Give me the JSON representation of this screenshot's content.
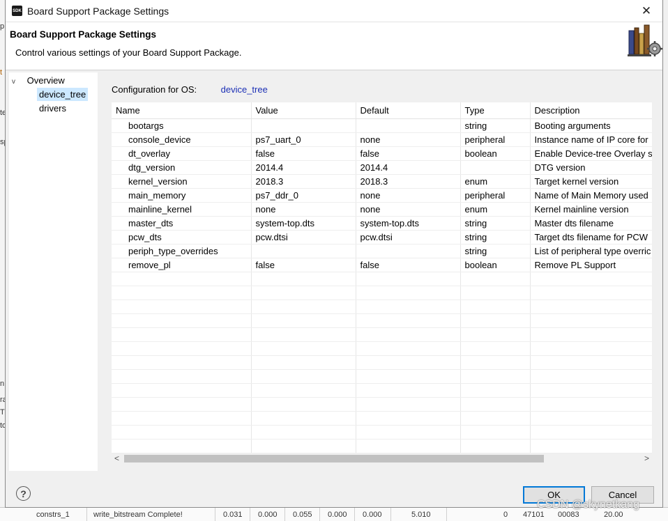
{
  "background": {
    "left_fragments": [
      "p",
      "t",
      "te",
      "sp",
      "n",
      "ra",
      "TC",
      "to"
    ],
    "bottom_cells": [
      "constrs_1",
      "write_bitstream Complete!",
      "0.031",
      "0.000",
      "0.055",
      "0.000",
      "0.000",
      "5.010",
      "0",
      "47101",
      "00083",
      "20.00"
    ]
  },
  "dialog": {
    "window_title": "Board Support Package Settings",
    "app_icon_text": "SDK",
    "close_glyph": "✕",
    "header_title": "Board Support Package Settings",
    "header_description": "Control various settings of your Board Support Package."
  },
  "tree": {
    "root": {
      "label": "Overview",
      "twisty": "v"
    },
    "children": [
      {
        "label": "device_tree",
        "selected": true
      },
      {
        "label": "drivers",
        "selected": false
      }
    ]
  },
  "config": {
    "label": "Configuration for OS:",
    "value": "device_tree"
  },
  "table": {
    "columns": [
      "Name",
      "Value",
      "Default",
      "Type",
      "Description"
    ],
    "rows": [
      [
        "bootargs",
        "",
        "",
        "string",
        "Booting arguments"
      ],
      [
        "console_device",
        "ps7_uart_0",
        "none",
        "peripheral",
        "Instance name of IP core for"
      ],
      [
        "dt_overlay",
        "false",
        "false",
        "boolean",
        "Enable Device-tree Overlay su"
      ],
      [
        "dtg_version",
        "2014.4",
        "2014.4",
        "",
        "DTG version"
      ],
      [
        "kernel_version",
        "2018.3",
        "2018.3",
        "enum",
        "Target kernel version"
      ],
      [
        "main_memory",
        "ps7_ddr_0",
        "none",
        "peripheral",
        "Name of Main Memory used"
      ],
      [
        "mainline_kernel",
        "none",
        "none",
        "enum",
        "Kernel mainline version"
      ],
      [
        "master_dts",
        "system-top.dts",
        "system-top.dts",
        "string",
        "Master dts filename"
      ],
      [
        "pcw_dts",
        "pcw.dtsi",
        "pcw.dtsi",
        "string",
        "Target dts filename for PCW"
      ],
      [
        "periph_type_overrides",
        "",
        "",
        "string",
        "List of peripheral type overric"
      ],
      [
        "remove_pl",
        "false",
        "false",
        "boolean",
        "Remove PL Support"
      ]
    ],
    "empty_rows": 13,
    "scroll_left": "<",
    "scroll_right": ">"
  },
  "footer": {
    "help_glyph": "?",
    "ok_label": "OK",
    "cancel_label": "Cancel"
  },
  "watermark": "CSDN @skynetkang",
  "colors": {
    "link_blue": "#1b2fb5",
    "selection": "#cce8ff",
    "default_button_border": "#0078d7"
  }
}
